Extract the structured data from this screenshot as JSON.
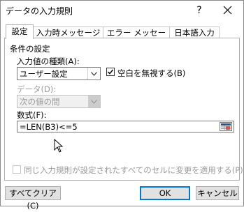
{
  "window": {
    "title": "データの入力規則",
    "help_glyph": "?",
    "close_glyph": "×"
  },
  "tabs": [
    {
      "label": "設定",
      "active": true
    },
    {
      "label": "入力時メッセージ",
      "active": false
    },
    {
      "label": "エラー メッセージ",
      "active": false
    },
    {
      "label": "日本語入力",
      "active": false
    }
  ],
  "conditions": {
    "group_label": "条件の設定",
    "allow_label": "入力値の種類(A):",
    "allow_value": "ユーザー設定",
    "ignore_blank_label": "空白を無視する(B)",
    "ignore_blank_checked": true,
    "data_label": "データ(D):",
    "data_value": "次の値の間",
    "formula_label": "数式(F):",
    "formula_value": "=LEN(B3)<=5"
  },
  "apply_all": {
    "label": "同じ入力規則が設定されたすべてのセルに変更を適用する(P)",
    "checked": false
  },
  "buttons": {
    "clear_all": "すべてクリア(C)",
    "ok": "OK",
    "cancel": "キャンセル"
  },
  "colors": {
    "accent": "#0078d7",
    "disabled_text": "#9a9a9a",
    "button_face": "#e1e1e1"
  }
}
